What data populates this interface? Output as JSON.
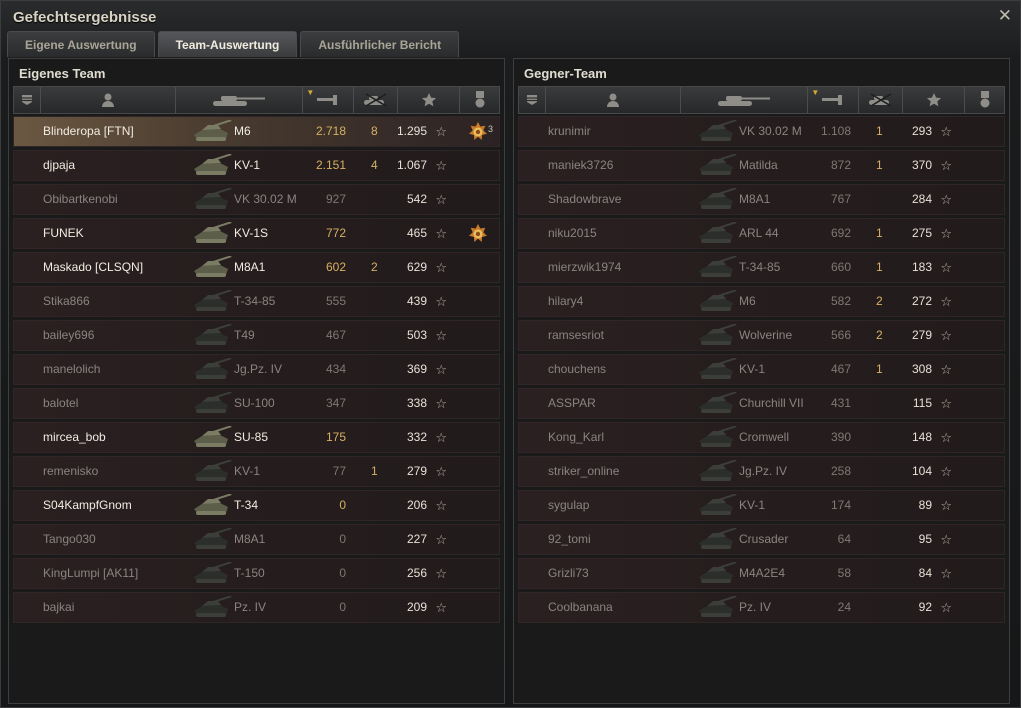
{
  "window": {
    "title": "Gefechtsergebnisse",
    "close_glyph": "✕"
  },
  "tabs": [
    {
      "label": "Eigene Auswertung",
      "active": false
    },
    {
      "label": "Team-Auswertung",
      "active": true
    },
    {
      "label": "Ausführlicher Bericht",
      "active": false
    }
  ],
  "header_icons": [
    "squad-icon",
    "player-icon",
    "tank-icon",
    "damage-icon",
    "kills-icon",
    "xp-star-icon",
    "medal-icon"
  ],
  "colors": {
    "accent": "#d8b062",
    "alive": "#f1ede2",
    "dead": "#8a8480"
  },
  "left_team": {
    "title": "Eigenes Team",
    "rows": [
      {
        "player": "Blinderopa [FTN]",
        "tank": "M6",
        "damage": "2.718",
        "kills": "8",
        "xp": "1.295",
        "medal": "medal",
        "medal_count": "3",
        "alive": true
      },
      {
        "player": "djpaja",
        "tank": "KV-1",
        "damage": "2.151",
        "kills": "4",
        "xp": "1.067",
        "medal": "",
        "medal_count": "",
        "alive": true
      },
      {
        "player": "Obibartkenobi",
        "tank": "VK 30.02 M",
        "damage": "927",
        "kills": "",
        "xp": "542",
        "medal": "",
        "medal_count": "",
        "alive": false
      },
      {
        "player": "FUNEK",
        "tank": "KV-1S",
        "damage": "772",
        "kills": "",
        "xp": "465",
        "medal": "medal",
        "medal_count": "",
        "alive": true
      },
      {
        "player": "Maskado [CLSQN]",
        "tank": "M8A1",
        "damage": "602",
        "kills": "2",
        "xp": "629",
        "medal": "",
        "medal_count": "",
        "alive": true
      },
      {
        "player": "Stika866",
        "tank": "T-34-85",
        "damage": "555",
        "kills": "",
        "xp": "439",
        "medal": "",
        "medal_count": "",
        "alive": false
      },
      {
        "player": "bailey696",
        "tank": "T49",
        "damage": "467",
        "kills": "",
        "xp": "503",
        "medal": "",
        "medal_count": "",
        "alive": false
      },
      {
        "player": "manelolich",
        "tank": "Jg.Pz. IV",
        "damage": "434",
        "kills": "",
        "xp": "369",
        "medal": "",
        "medal_count": "",
        "alive": false
      },
      {
        "player": "balotel",
        "tank": "SU-100",
        "damage": "347",
        "kills": "",
        "xp": "338",
        "medal": "",
        "medal_count": "",
        "alive": false
      },
      {
        "player": "mircea_bob",
        "tank": "SU-85",
        "damage": "175",
        "kills": "",
        "xp": "332",
        "medal": "",
        "medal_count": "",
        "alive": true
      },
      {
        "player": "remenisko",
        "tank": "KV-1",
        "damage": "77",
        "kills": "1",
        "xp": "279",
        "medal": "",
        "medal_count": "",
        "alive": false
      },
      {
        "player": "S04KampfGnom",
        "tank": "T-34",
        "damage": "0",
        "kills": "",
        "xp": "206",
        "medal": "",
        "medal_count": "",
        "alive": true
      },
      {
        "player": "Tango030",
        "tank": "M8A1",
        "damage": "0",
        "kills": "",
        "xp": "227",
        "medal": "",
        "medal_count": "",
        "alive": false
      },
      {
        "player": "KingLumpi [AK11]",
        "tank": "T-150",
        "damage": "0",
        "kills": "",
        "xp": "256",
        "medal": "",
        "medal_count": "",
        "alive": false
      },
      {
        "player": "bajkai",
        "tank": "Pz. IV",
        "damage": "0",
        "kills": "",
        "xp": "209",
        "medal": "",
        "medal_count": "",
        "alive": false
      }
    ]
  },
  "right_team": {
    "title": "Gegner-Team",
    "rows": [
      {
        "player": "krunimir",
        "tank": "VK 30.02 M",
        "damage": "1.108",
        "kills": "1",
        "xp": "293",
        "medal": "",
        "medal_count": "",
        "alive": false
      },
      {
        "player": "maniek3726",
        "tank": "Matilda",
        "damage": "872",
        "kills": "1",
        "xp": "370",
        "medal": "",
        "medal_count": "",
        "alive": false
      },
      {
        "player": "Shadowbrave",
        "tank": "M8A1",
        "damage": "767",
        "kills": "",
        "xp": "284",
        "medal": "",
        "medal_count": "",
        "alive": false
      },
      {
        "player": "niku2015",
        "tank": "ARL 44",
        "damage": "692",
        "kills": "1",
        "xp": "275",
        "medal": "",
        "medal_count": "",
        "alive": false
      },
      {
        "player": "mierzwik1974",
        "tank": "T-34-85",
        "damage": "660",
        "kills": "1",
        "xp": "183",
        "medal": "",
        "medal_count": "",
        "alive": false
      },
      {
        "player": "hilary4",
        "tank": "M6",
        "damage": "582",
        "kills": "2",
        "xp": "272",
        "medal": "",
        "medal_count": "",
        "alive": false
      },
      {
        "player": "ramsesriot",
        "tank": "Wolverine",
        "damage": "566",
        "kills": "2",
        "xp": "279",
        "medal": "",
        "medal_count": "",
        "alive": false
      },
      {
        "player": "chouchens",
        "tank": "KV-1",
        "damage": "467",
        "kills": "1",
        "xp": "308",
        "medal": "",
        "medal_count": "",
        "alive": false
      },
      {
        "player": "ASSPAR",
        "tank": "Churchill VII",
        "damage": "431",
        "kills": "",
        "xp": "115",
        "medal": "",
        "medal_count": "",
        "alive": false
      },
      {
        "player": "Kong_Karl",
        "tank": "Cromwell",
        "damage": "390",
        "kills": "",
        "xp": "148",
        "medal": "",
        "medal_count": "",
        "alive": false
      },
      {
        "player": "striker_online",
        "tank": "Jg.Pz. IV",
        "damage": "258",
        "kills": "",
        "xp": "104",
        "medal": "",
        "medal_count": "",
        "alive": false
      },
      {
        "player": "sygulap",
        "tank": "KV-1",
        "damage": "174",
        "kills": "",
        "xp": "89",
        "medal": "",
        "medal_count": "",
        "alive": false
      },
      {
        "player": "92_tomi",
        "tank": "Crusader",
        "damage": "64",
        "kills": "",
        "xp": "95",
        "medal": "",
        "medal_count": "",
        "alive": false
      },
      {
        "player": "Grizli73",
        "tank": "M4A2E4",
        "damage": "58",
        "kills": "",
        "xp": "84",
        "medal": "",
        "medal_count": "",
        "alive": false
      },
      {
        "player": "Coolbanana",
        "tank": "Pz. IV",
        "damage": "24",
        "kills": "",
        "xp": "92",
        "medal": "",
        "medal_count": "",
        "alive": false
      }
    ]
  }
}
